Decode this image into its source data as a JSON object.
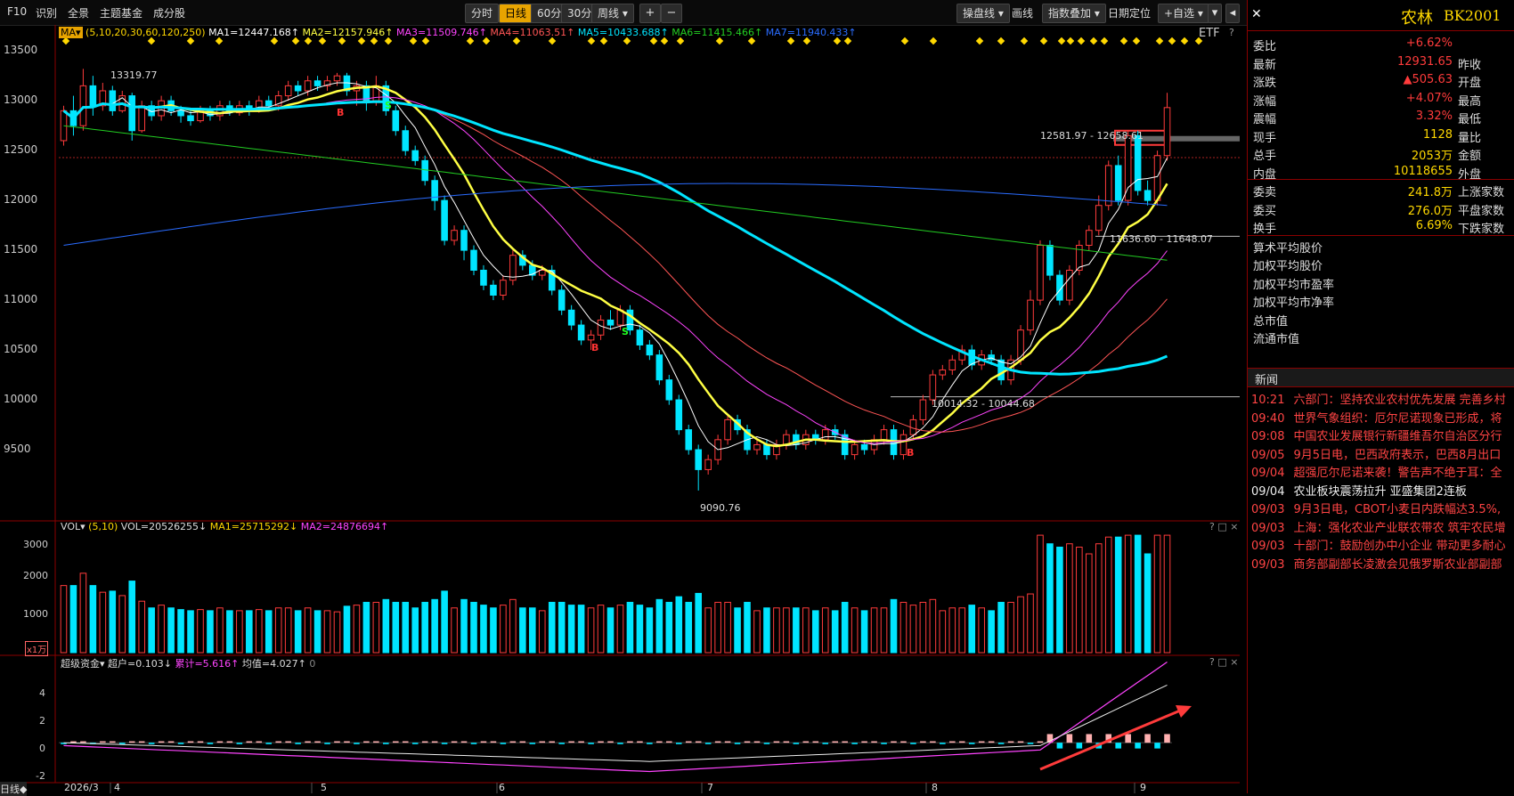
{
  "toolbar": {
    "left_items": [
      "F10",
      "识别",
      "全景",
      "主题基金",
      "成分股"
    ],
    "periods": [
      "分时",
      "日线",
      "60分",
      "30分",
      "周线"
    ],
    "active_period": "日线",
    "plus": "+",
    "minus": "−",
    "right_items": [
      "操盘线",
      "画线",
      "指数叠加",
      "日期定位",
      "+自选"
    ]
  },
  "colors": {
    "up": "#ff3b3b",
    "down": "#00e5ff",
    "ma1": "#ffffff",
    "ma2": "#ffff44",
    "ma3": "#ff44ff",
    "ma4": "#ff5555",
    "ma5": "#00e5ff",
    "ma6": "#22cc22",
    "ma7": "#2a6cff"
  },
  "main": {
    "indicator_label": "MA",
    "params": "(5,10,20,30,60,120,250)",
    "ma": [
      {
        "label": "MA1=12447.168↑",
        "color": "#ffffff"
      },
      {
        "label": "MA2=12157.946↑",
        "color": "#ffff44"
      },
      {
        "label": "MA3=11509.746↑",
        "color": "#ff44ff"
      },
      {
        "label": "MA4=11063.51↑",
        "color": "#ff5555"
      },
      {
        "label": "MA5=10433.688↑",
        "color": "#00e5ff"
      },
      {
        "label": "MA6=11415.466↑",
        "color": "#22cc22"
      },
      {
        "label": "MA7=11940.433↑",
        "color": "#2a6cff"
      }
    ],
    "etf": "ETF",
    "help": "?",
    "y_labels": [
      "13500",
      "13000",
      "12500",
      "12000",
      "11500",
      "11000",
      "10500",
      "10000",
      "9500"
    ],
    "annotations": {
      "high": "13319.77",
      "low": "9090.76",
      "gap1": "12581.97 - 12658.61",
      "gap2": "11636.60 - 11648.07",
      "gap3": "10014.32 - 10044.68"
    },
    "signals": [
      "B",
      "S",
      "B",
      "S",
      "B"
    ]
  },
  "chart_data": {
    "type": "candlestick",
    "ylim": [
      9000,
      13600
    ],
    "candles": [
      [
        12600,
        12900,
        12550,
        12950
      ],
      [
        12900,
        12750,
        12650,
        13050
      ],
      [
        12750,
        13150,
        12700,
        13320
      ],
      [
        13150,
        12950,
        12850,
        13250
      ],
      [
        12950,
        13100,
        12900,
        13180
      ],
      [
        13100,
        12900,
        12850,
        13150
      ],
      [
        12900,
        13050,
        12880,
        13100
      ],
      [
        13050,
        12700,
        12600,
        13080
      ],
      [
        12700,
        12950,
        12680,
        13000
      ],
      [
        12950,
        12850,
        12800,
        13000
      ],
      [
        12850,
        13000,
        12800,
        13050
      ],
      [
        13000,
        12900,
        12850,
        13050
      ],
      [
        12900,
        12850,
        12780,
        12950
      ],
      [
        12850,
        12800,
        12750,
        12900
      ],
      [
        12800,
        12900,
        12780,
        12950
      ],
      [
        12900,
        12850,
        12800,
        12950
      ],
      [
        12850,
        12950,
        12800,
        13000
      ],
      [
        12950,
        12880,
        12850,
        13000
      ],
      [
        12880,
        12950,
        12850,
        13000
      ],
      [
        12950,
        12900,
        12850,
        13000
      ],
      [
        12900,
        13000,
        12880,
        13050
      ],
      [
        13000,
        12950,
        12900,
        13050
      ],
      [
        12950,
        13050,
        12900,
        13100
      ],
      [
        13050,
        13150,
        13000,
        13200
      ],
      [
        13150,
        13100,
        13050,
        13200
      ],
      [
        13100,
        13200,
        13050,
        13250
      ],
      [
        13200,
        13150,
        13100,
        13250
      ],
      [
        13150,
        13200,
        13100,
        13250
      ],
      [
        13200,
        13250,
        13150,
        13280
      ],
      [
        13250,
        13100,
        13050,
        13280
      ],
      [
        13100,
        13150,
        12950,
        13200
      ],
      [
        13150,
        13000,
        12900,
        13200
      ],
      [
        13000,
        13150,
        12950,
        13250
      ],
      [
        13150,
        12900,
        12850,
        13200
      ],
      [
        12900,
        12700,
        12650,
        12950
      ],
      [
        12700,
        12500,
        12450,
        12750
      ],
      [
        12500,
        12400,
        12350,
        12550
      ],
      [
        12400,
        12200,
        12150,
        12450
      ],
      [
        12200,
        12000,
        11900,
        12250
      ],
      [
        12000,
        11600,
        11550,
        12050
      ],
      [
        11600,
        11700,
        11550,
        11750
      ],
      [
        11700,
        11500,
        11400,
        11750
      ],
      [
        11500,
        11300,
        11250,
        11550
      ],
      [
        11300,
        11150,
        11100,
        11350
      ],
      [
        11150,
        11050,
        11000,
        11200
      ],
      [
        11050,
        11200,
        11000,
        11250
      ],
      [
        11200,
        11450,
        11150,
        11500
      ],
      [
        11450,
        11350,
        11300,
        11500
      ],
      [
        11350,
        11250,
        11200,
        11400
      ],
      [
        11250,
        11300,
        11200,
        11350
      ],
      [
        11300,
        11100,
        11050,
        11350
      ],
      [
        11100,
        10900,
        10850,
        11150
      ],
      [
        10900,
        10750,
        10700,
        10950
      ],
      [
        10750,
        10600,
        10550,
        10800
      ],
      [
        10600,
        10650,
        10500,
        10700
      ],
      [
        10650,
        10800,
        10600,
        10850
      ],
      [
        10800,
        10750,
        10700,
        10900
      ],
      [
        10750,
        10900,
        10700,
        10950
      ],
      [
        10900,
        10700,
        10650,
        10950
      ],
      [
        10700,
        10550,
        10500,
        10750
      ],
      [
        10550,
        10450,
        10400,
        10600
      ],
      [
        10450,
        10200,
        10150,
        10500
      ],
      [
        10200,
        10000,
        9950,
        10250
      ],
      [
        10000,
        9700,
        9650,
        10050
      ],
      [
        9700,
        9500,
        9450,
        9750
      ],
      [
        9500,
        9300,
        9090,
        9550
      ],
      [
        9300,
        9400,
        9250,
        9450
      ],
      [
        9400,
        9600,
        9350,
        9650
      ],
      [
        9600,
        9800,
        9550,
        9850
      ],
      [
        9800,
        9700,
        9650,
        9850
      ],
      [
        9700,
        9500,
        9450,
        9750
      ],
      [
        9500,
        9550,
        9450,
        9600
      ],
      [
        9550,
        9450,
        9400,
        9600
      ],
      [
        9450,
        9550,
        9400,
        9600
      ],
      [
        9550,
        9650,
        9500,
        9700
      ],
      [
        9650,
        9550,
        9500,
        9700
      ],
      [
        9550,
        9650,
        9500,
        9700
      ],
      [
        9650,
        9600,
        9550,
        9700
      ],
      [
        9600,
        9700,
        9550,
        9750
      ],
      [
        9700,
        9650,
        9600,
        9750
      ],
      [
        9650,
        9450,
        9400,
        9700
      ],
      [
        9450,
        9550,
        9400,
        9600
      ],
      [
        9550,
        9500,
        9450,
        9600
      ],
      [
        9500,
        9600,
        9450,
        9650
      ],
      [
        9600,
        9700,
        9550,
        9750
      ],
      [
        9700,
        9450,
        9400,
        9750
      ],
      [
        9450,
        9650,
        9400,
        9700
      ],
      [
        9650,
        9800,
        9600,
        9850
      ],
      [
        9800,
        10000,
        9750,
        10050
      ],
      [
        10000,
        10250,
        9950,
        10300
      ],
      [
        10250,
        10300,
        10200,
        10350
      ],
      [
        10300,
        10400,
        10250,
        10450
      ],
      [
        10400,
        10500,
        10350,
        10550
      ],
      [
        10500,
        10350,
        10300,
        10550
      ],
      [
        10350,
        10450,
        10300,
        10500
      ],
      [
        10450,
        10400,
        10350,
        10500
      ],
      [
        10400,
        10200,
        10150,
        10450
      ],
      [
        10200,
        10400,
        10150,
        10450
      ],
      [
        10400,
        10700,
        10350,
        10750
      ],
      [
        10700,
        11000,
        10650,
        11100
      ],
      [
        11000,
        11550,
        10950,
        11600
      ],
      [
        11550,
        11250,
        11200,
        11600
      ],
      [
        11250,
        11000,
        10950,
        11300
      ],
      [
        11000,
        11300,
        10950,
        11350
      ],
      [
        11300,
        11550,
        11250,
        11600
      ],
      [
        11550,
        11700,
        11500,
        11750
      ],
      [
        11700,
        11950,
        11650,
        12050
      ],
      [
        11950,
        12350,
        11900,
        12400
      ],
      [
        12350,
        12000,
        11950,
        12450
      ],
      [
        12000,
        12650,
        11950,
        12700
      ],
      [
        12650,
        12100,
        12050,
        12700
      ],
      [
        12100,
        12000,
        11950,
        12200
      ],
      [
        12000,
        12450,
        11950,
        12500
      ],
      [
        12450,
        12931.65,
        12400,
        13080
      ]
    ]
  },
  "vol": {
    "label": "VOL",
    "params": "(5,10)",
    "vol_label": "VOL=20526255↓",
    "ma1_label": "MA1=25715292↓",
    "ma2_label": "MA2=24876694↑",
    "y_labels": [
      "3000",
      "2000",
      "1000"
    ],
    "unit": "x1万"
  },
  "fund": {
    "label": "超级资金",
    "super_label": "超户=0.103↓",
    "cum_label": "累计=5.616↑",
    "avg_label": "均值=4.027↑",
    "zero": "0",
    "y_labels": [
      "4",
      "2",
      "0",
      "-2"
    ]
  },
  "xaxis": {
    "labels": [
      "2026/3",
      "4",
      "5",
      "6",
      "7",
      "8",
      "9"
    ],
    "period_btn": "日线◆"
  },
  "quote": {
    "name": "农林",
    "code": "BK2001",
    "rows": [
      {
        "k": "委比",
        "v": "+6.62%",
        "k2": ""
      },
      {
        "k": "最新",
        "v": "12931.65",
        "k2": "昨收"
      },
      {
        "k": "涨跌",
        "v": "▲505.63",
        "k2": "开盘"
      },
      {
        "k": "涨幅",
        "v": "+4.07%",
        "k2": "最高"
      },
      {
        "k": "震幅",
        "v": "3.32%",
        "k2": "最低"
      },
      {
        "k": "现手",
        "v": "1128",
        "k2": "量比"
      },
      {
        "k": "总手",
        "v": "2053万",
        "k2": "金额"
      },
      {
        "k": "内盘",
        "v": "10118655",
        "k2": "外盘"
      },
      {
        "k": "委卖",
        "v": "241.8万",
        "k2": "上涨家数"
      },
      {
        "k": "委买",
        "v": "276.0万",
        "k2": "平盘家数"
      },
      {
        "k": "换手",
        "v": "6.69%",
        "k2": "下跌家数"
      }
    ],
    "extra": [
      "算术平均股价",
      "加权平均股价",
      "加权平均市盈率",
      "加权平均市净率",
      "总市值",
      "流通市值"
    ]
  },
  "news": {
    "title": "新闻",
    "items": [
      {
        "t": "10:21",
        "h": "六部门：坚持农业农村优先发展 完善乡村",
        "white": false
      },
      {
        "t": "09:40",
        "h": "世界气象组织：厄尔尼诺现象已形成，将",
        "white": false
      },
      {
        "t": "09:08",
        "h": "中国农业发展银行新疆维吾尔自治区分行",
        "white": false
      },
      {
        "t": "09/05",
        "h": "9月5日电，巴西政府表示，巴西8月出口",
        "white": false
      },
      {
        "t": "09/04",
        "h": "超强厄尔尼诺来袭！警告声不绝于耳：全",
        "white": false
      },
      {
        "t": "09/04",
        "h": "农业板块震荡拉升 亚盛集团2连板",
        "white": true
      },
      {
        "t": "09/03",
        "h": "9月3日电，CBOT小麦日内跌幅达3.5%,",
        "white": false
      },
      {
        "t": "09/03",
        "h": "上海：强化农业产业联农带农 筑牢农民增",
        "white": false
      },
      {
        "t": "09/03",
        "h": "十部门：鼓励创办中小企业 带动更多耐心",
        "white": false
      },
      {
        "t": "09/03",
        "h": "商务部副部长凌激会见俄罗斯农业部副部",
        "white": false
      }
    ]
  }
}
